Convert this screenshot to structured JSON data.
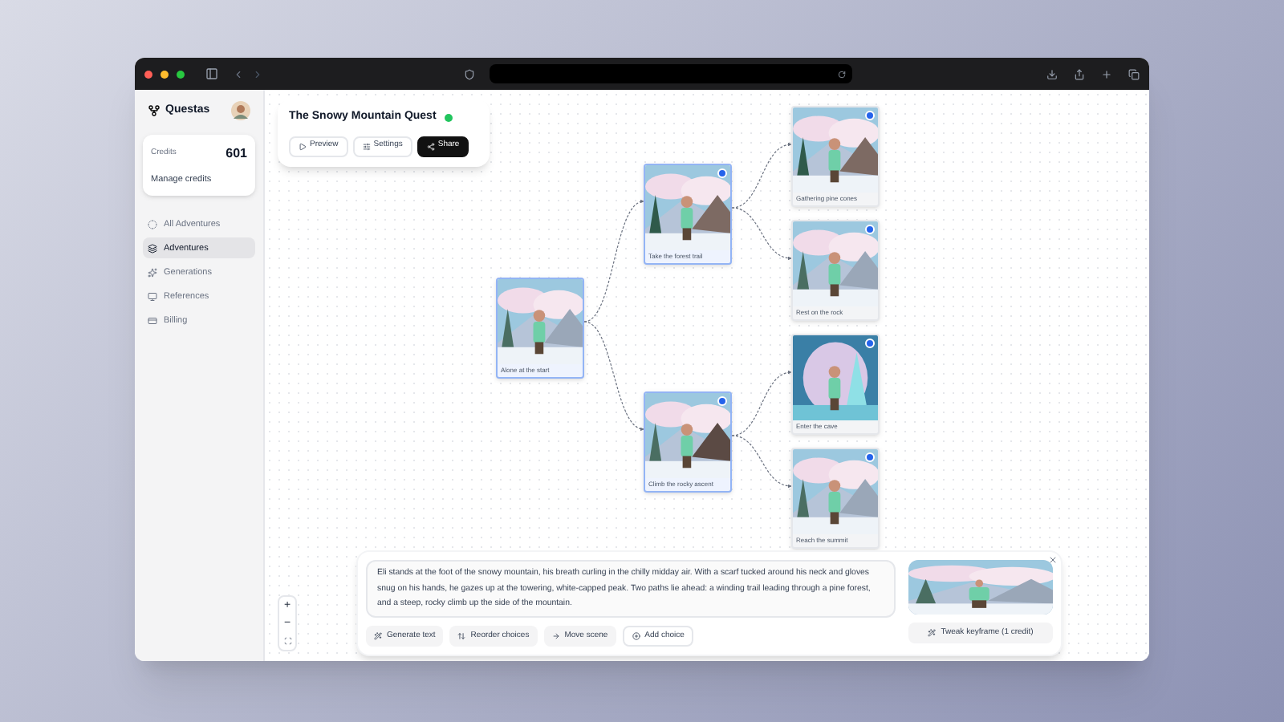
{
  "sidebar": {
    "brand": "Questas",
    "credits": {
      "label": "Credits",
      "value": "601",
      "link": "Manage credits"
    },
    "nav": [
      {
        "label": "All Adventures",
        "selected": false
      },
      {
        "label": "Adventures",
        "selected": true
      },
      {
        "label": "Generations",
        "selected": false
      },
      {
        "label": "References",
        "selected": false
      },
      {
        "label": "Billing",
        "selected": false
      }
    ]
  },
  "story_card": {
    "title": "The Snowy Mountain Quest",
    "published": true,
    "buttons": [
      "Preview",
      "Settings",
      "Share"
    ]
  },
  "story_tree": {
    "label": "Alone at the start",
    "badge": false,
    "highlighted": true,
    "kind": "snow",
    "children": [
      {
        "label": "Take the forest trail",
        "badge": true,
        "highlighted": true,
        "kind": "forest",
        "children": [
          {
            "label": "Gathering pine cones",
            "badge": true,
            "highlighted": false,
            "kind": "forest"
          },
          {
            "label": "Rest on the rock",
            "badge": true,
            "highlighted": false,
            "kind": "snow"
          }
        ]
      },
      {
        "label": "Climb the rocky ascent",
        "badge": true,
        "highlighted": true,
        "kind": "rock",
        "children": [
          {
            "label": "Enter the cave",
            "badge": true,
            "highlighted": false,
            "kind": "cave"
          },
          {
            "label": "Reach the summit",
            "badge": true,
            "highlighted": false,
            "kind": "snow"
          }
        ]
      }
    ]
  },
  "zoom_controls": [
    "+",
    "−"
  ],
  "scene_panel": {
    "text": "Eli stands at the foot of the snowy mountain, his breath curling in the chilly midday air. With a scarf tucked around his neck and gloves snug on his hands, he gazes up at the towering, white-capped peak. Two paths lie ahead: a winding trail leading through a pine forest, and a steep, rocky climb up the side of the mountain.",
    "actions": [
      "Generate text",
      "Reorder choices",
      "Move scene",
      "Add choice"
    ],
    "tweak_button": "Tweak keyframe (1 credit)"
  }
}
